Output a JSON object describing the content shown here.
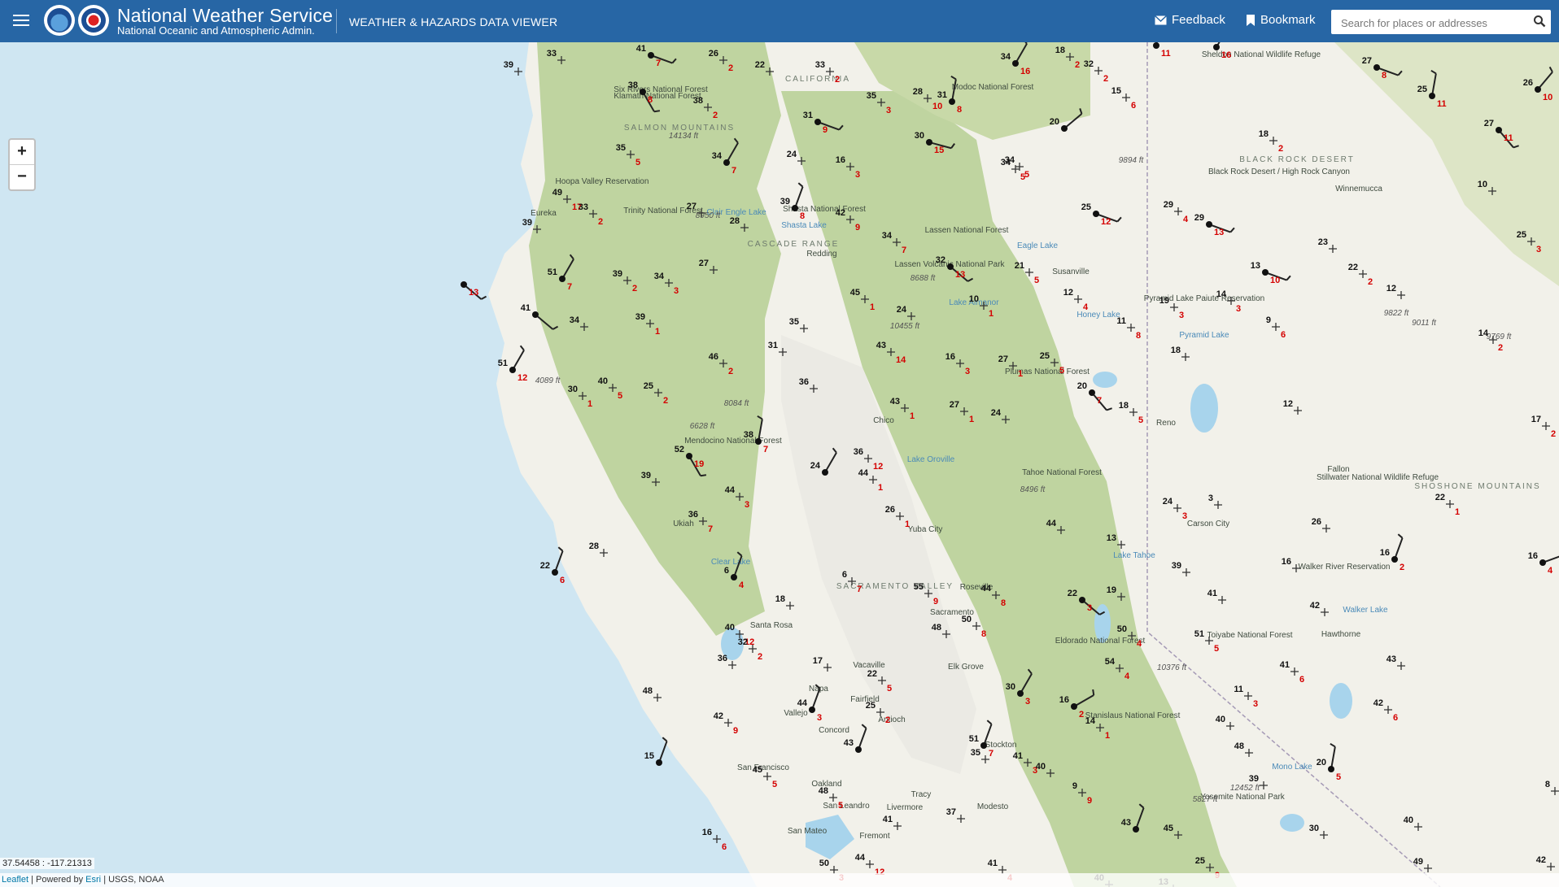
{
  "header": {
    "title": "National Weather Service",
    "subtitle": "National Oceanic and Atmospheric Admin.",
    "app_title": "WEATHER & HAZARDS DATA VIEWER",
    "feedback_label": "Feedback",
    "bookmark_label": "Bookmark",
    "search_placeholder": "Search for places or addresses"
  },
  "map": {
    "zoom_in": "+",
    "zoom_out": "−",
    "coordinates": "37.54458 : -117.21313",
    "attribution": {
      "leaflet": "Leaflet",
      "powered_by": "| Powered by",
      "esri": "Esri",
      "sources": "| USGS, NOAA"
    },
    "colors": {
      "ocean": "#cfe6f2",
      "land": "#f2f1ea",
      "forest": "#bfd4a0",
      "valley": "#ededed",
      "temp": "#111111",
      "dewpoint": "#d40000",
      "header": "#2766a5"
    },
    "place_labels": [
      "Six Rivers National Forest",
      "Klamath National Forest",
      "CALIFORNIA",
      "Modoc National Forest",
      "Sheldon National Wildlife Refuge",
      "Black Rock Desert / High Rock Canyon",
      "BLACK ROCK DESERT",
      "Winnemucca",
      "Hoopa Valley Reservation",
      "Trinity National Forest",
      "Shasta National Forest",
      "Shasta Lake",
      "Clair Engle Lake",
      "SALMON MOUNTAINS",
      "Eureka",
      "CASCADE RANGE",
      "Lassen National Forest",
      "Eagle Lake",
      "Susanville",
      "Redding",
      "Lassen Volcanic National Park",
      "Pyramid Lake Paiute Reservation",
      "Pyramid Lake",
      "Honey Lake",
      "Lake Almanor",
      "Plumas National Forest",
      "Mendocino National Forest",
      "Chico",
      "Lake Oroville",
      "Reno",
      "Fallon",
      "Stillwater National Wildlife Refuge",
      "SHOSHONE MOUNTAINS",
      "Tahoe National Forest",
      "Carson City",
      "Walker River Reservation",
      "Ukiah",
      "Yuba City",
      "Lake Tahoe",
      "Clear Lake",
      "SACRAMENTO VALLEY",
      "Roseville",
      "Sacramento",
      "Eldorado National Forest",
      "Toiyabe National Forest",
      "Walker Lake",
      "Hawthorne",
      "Santa Rosa",
      "Vacaville",
      "Elk Grove",
      "Napa",
      "Fairfield",
      "Vallejo",
      "Stanislaus National Forest",
      "Mono Lake",
      "Antioch",
      "Concord",
      "Stockton",
      "San Francisco",
      "Oakland",
      "Tracy",
      "San Leandro",
      "Livermore",
      "Modesto",
      "Yosemite National Park",
      "San Mateo",
      "Fremont"
    ],
    "elevation_labels": [
      "14134 ft",
      "9894 ft",
      "8950 ft",
      "8688 ft",
      "10455 ft",
      "9822 ft",
      "9011 ft",
      "9769 ft",
      "4089 ft",
      "8084 ft",
      "6628 ft",
      "8496 ft",
      "10376 ft",
      "12452 ft",
      "5827 ft"
    ],
    "stations": [
      {
        "t": "33",
        "d": ""
      },
      {
        "t": "41",
        "d": "7"
      },
      {
        "t": "26",
        "d": "2"
      },
      {
        "t": "22",
        "d": ""
      },
      {
        "t": "33",
        "d": "2"
      },
      {
        "t": "34",
        "d": "16"
      },
      {
        "t": "18",
        "d": "2"
      },
      {
        "t": "32",
        "d": "2"
      },
      {
        "t": "",
        "d": "11"
      },
      {
        "t": "",
        "d": "16"
      },
      {
        "t": "27",
        "d": "8"
      },
      {
        "t": "25",
        "d": "11"
      },
      {
        "t": "26",
        "d": "10"
      },
      {
        "t": "39",
        "d": ""
      },
      {
        "t": "38",
        "d": "8"
      },
      {
        "t": "38",
        "d": "2"
      },
      {
        "t": "35",
        "d": "3"
      },
      {
        "t": "28",
        "d": "10"
      },
      {
        "t": "31",
        "d": "8"
      },
      {
        "t": "15",
        "d": "6"
      },
      {
        "t": "27",
        "d": "11"
      },
      {
        "t": "31",
        "d": "9"
      },
      {
        "t": "20",
        "d": ""
      },
      {
        "t": "18",
        "d": "2"
      },
      {
        "t": "35",
        "d": "5"
      },
      {
        "t": "34",
        "d": "7"
      },
      {
        "t": "34",
        "d": "5"
      },
      {
        "t": "30",
        "d": "15"
      },
      {
        "t": "24",
        "d": ""
      },
      {
        "t": "16",
        "d": "3"
      },
      {
        "t": "34",
        "d": "5"
      },
      {
        "t": "10",
        "d": ""
      },
      {
        "t": "49",
        "d": "17"
      },
      {
        "t": "33",
        "d": "2"
      },
      {
        "t": "27",
        "d": ""
      },
      {
        "t": "39",
        "d": "8"
      },
      {
        "t": "42",
        "d": "9"
      },
      {
        "t": "28",
        "d": ""
      },
      {
        "t": "25",
        "d": "12"
      },
      {
        "t": "29",
        "d": "4"
      },
      {
        "t": "29",
        "d": "13"
      },
      {
        "t": "39",
        "d": ""
      },
      {
        "t": "34",
        "d": "7"
      },
      {
        "t": "23",
        "d": ""
      },
      {
        "t": "25",
        "d": "3"
      },
      {
        "t": "32",
        "d": "13"
      },
      {
        "t": "21",
        "d": "5"
      },
      {
        "t": "13",
        "d": "10"
      },
      {
        "t": "22",
        "d": "2"
      },
      {
        "t": "51",
        "d": "7"
      },
      {
        "t": "39",
        "d": "2"
      },
      {
        "t": "34",
        "d": "3"
      },
      {
        "t": "27",
        "d": ""
      },
      {
        "t": "45",
        "d": "1"
      },
      {
        "t": "24",
        "d": ""
      },
      {
        "t": "10",
        "d": "1"
      },
      {
        "t": "12",
        "d": "4"
      },
      {
        "t": "19",
        "d": "3"
      },
      {
        "t": "14",
        "d": "3"
      },
      {
        "t": "12",
        "d": ""
      },
      {
        "t": "",
        "d": "13"
      },
      {
        "t": "41",
        "d": ""
      },
      {
        "t": "34",
        "d": ""
      },
      {
        "t": "39",
        "d": "1"
      },
      {
        "t": "35",
        "d": ""
      },
      {
        "t": "11",
        "d": "8"
      },
      {
        "t": "9",
        "d": "6"
      },
      {
        "t": "14",
        "d": "2"
      },
      {
        "t": "31",
        "d": ""
      },
      {
        "t": "43",
        "d": "14"
      },
      {
        "t": "16",
        "d": "3"
      },
      {
        "t": "27",
        "d": "1"
      },
      {
        "t": "18",
        "d": ""
      },
      {
        "t": "51",
        "d": "12"
      },
      {
        "t": "40",
        "d": "5"
      },
      {
        "t": "30",
        "d": "1"
      },
      {
        "t": "25",
        "d": "2"
      },
      {
        "t": "46",
        "d": "2"
      },
      {
        "t": "36",
        "d": ""
      },
      {
        "t": "25",
        "d": "5"
      },
      {
        "t": "20",
        "d": "7"
      },
      {
        "t": "43",
        "d": "1"
      },
      {
        "t": "27",
        "d": "1"
      },
      {
        "t": "24",
        "d": ""
      },
      {
        "t": "18",
        "d": "5"
      },
      {
        "t": "12",
        "d": ""
      },
      {
        "t": "17",
        "d": "2"
      },
      {
        "t": "38",
        "d": "7"
      },
      {
        "t": "52",
        "d": "19"
      },
      {
        "t": "36",
        "d": "12"
      },
      {
        "t": "39",
        "d": ""
      },
      {
        "t": "44",
        "d": "3"
      },
      {
        "t": "44",
        "d": "1"
      },
      {
        "t": "3",
        "d": ""
      },
      {
        "t": "22",
        "d": "1"
      },
      {
        "t": "24",
        "d": "3"
      },
      {
        "t": "24",
        "d": ""
      },
      {
        "t": "36",
        "d": "7"
      },
      {
        "t": "26",
        "d": "1"
      },
      {
        "t": "44",
        "d": ""
      },
      {
        "t": "26",
        "d": ""
      },
      {
        "t": "13",
        "d": ""
      },
      {
        "t": "28",
        "d": ""
      },
      {
        "t": "39",
        "d": ""
      },
      {
        "t": "16",
        "d": ""
      },
      {
        "t": "16",
        "d": "2"
      },
      {
        "t": "16",
        "d": "4"
      },
      {
        "t": "22",
        "d": "6"
      },
      {
        "t": "6",
        "d": "4"
      },
      {
        "t": "6",
        "d": "7"
      },
      {
        "t": "55",
        "d": "9"
      },
      {
        "t": "44",
        "d": "8"
      },
      {
        "t": "41",
        "d": ""
      },
      {
        "t": "42",
        "d": ""
      },
      {
        "t": "18",
        "d": ""
      },
      {
        "t": "22",
        "d": "3"
      },
      {
        "t": "19",
        "d": ""
      },
      {
        "t": "50",
        "d": "8"
      },
      {
        "t": "40",
        "d": "12"
      },
      {
        "t": "32",
        "d": "2"
      },
      {
        "t": "48",
        "d": ""
      },
      {
        "t": "50",
        "d": "4"
      },
      {
        "t": "51",
        "d": "5"
      },
      {
        "t": "36",
        "d": ""
      },
      {
        "t": "17",
        "d": ""
      },
      {
        "t": "22",
        "d": "5"
      },
      {
        "t": "54",
        "d": "4"
      },
      {
        "t": "41",
        "d": "6"
      },
      {
        "t": "43",
        "d": ""
      },
      {
        "t": "48",
        "d": ""
      },
      {
        "t": "30",
        "d": "3"
      },
      {
        "t": "16",
        "d": "2"
      },
      {
        "t": "11",
        "d": "3"
      },
      {
        "t": "42",
        "d": "6"
      },
      {
        "t": "42",
        "d": "9"
      },
      {
        "t": "44",
        "d": "3"
      },
      {
        "t": "25",
        "d": "2"
      },
      {
        "t": "14",
        "d": "1"
      },
      {
        "t": "40",
        "d": ""
      },
      {
        "t": "51",
        "d": "7"
      },
      {
        "t": "43",
        "d": ""
      },
      {
        "t": "41",
        "d": "3"
      },
      {
        "t": "48",
        "d": ""
      },
      {
        "t": "15",
        "d": ""
      },
      {
        "t": "45",
        "d": "5"
      },
      {
        "t": "35",
        "d": ""
      },
      {
        "t": "40",
        "d": ""
      },
      {
        "t": "20",
        "d": "5"
      },
      {
        "t": "9",
        "d": "9"
      },
      {
        "t": "39",
        "d": ""
      },
      {
        "t": "48",
        "d": "5"
      },
      {
        "t": "41",
        "d": ""
      },
      {
        "t": "8",
        "d": "10"
      },
      {
        "t": "37",
        "d": ""
      },
      {
        "t": "16",
        "d": "6"
      },
      {
        "t": "43",
        "d": ""
      },
      {
        "t": "45",
        "d": ""
      },
      {
        "t": "30",
        "d": ""
      },
      {
        "t": "40",
        "d": ""
      },
      {
        "t": "50",
        "d": "3"
      },
      {
        "t": "44",
        "d": "12"
      },
      {
        "t": "41",
        "d": "4"
      },
      {
        "t": "25",
        "d": "9"
      },
      {
        "t": "13",
        "d": "3"
      },
      {
        "t": "49",
        "d": ""
      },
      {
        "t": "42",
        "d": ""
      },
      {
        "t": "40",
        "d": ""
      },
      {
        "t": "35",
        "d": ""
      },
      {
        "t": "11",
        "d": ""
      },
      {
        "t": "8",
        "d": "5"
      },
      {
        "t": "30",
        "d": ""
      },
      {
        "t": "54",
        "d": ""
      }
    ]
  }
}
